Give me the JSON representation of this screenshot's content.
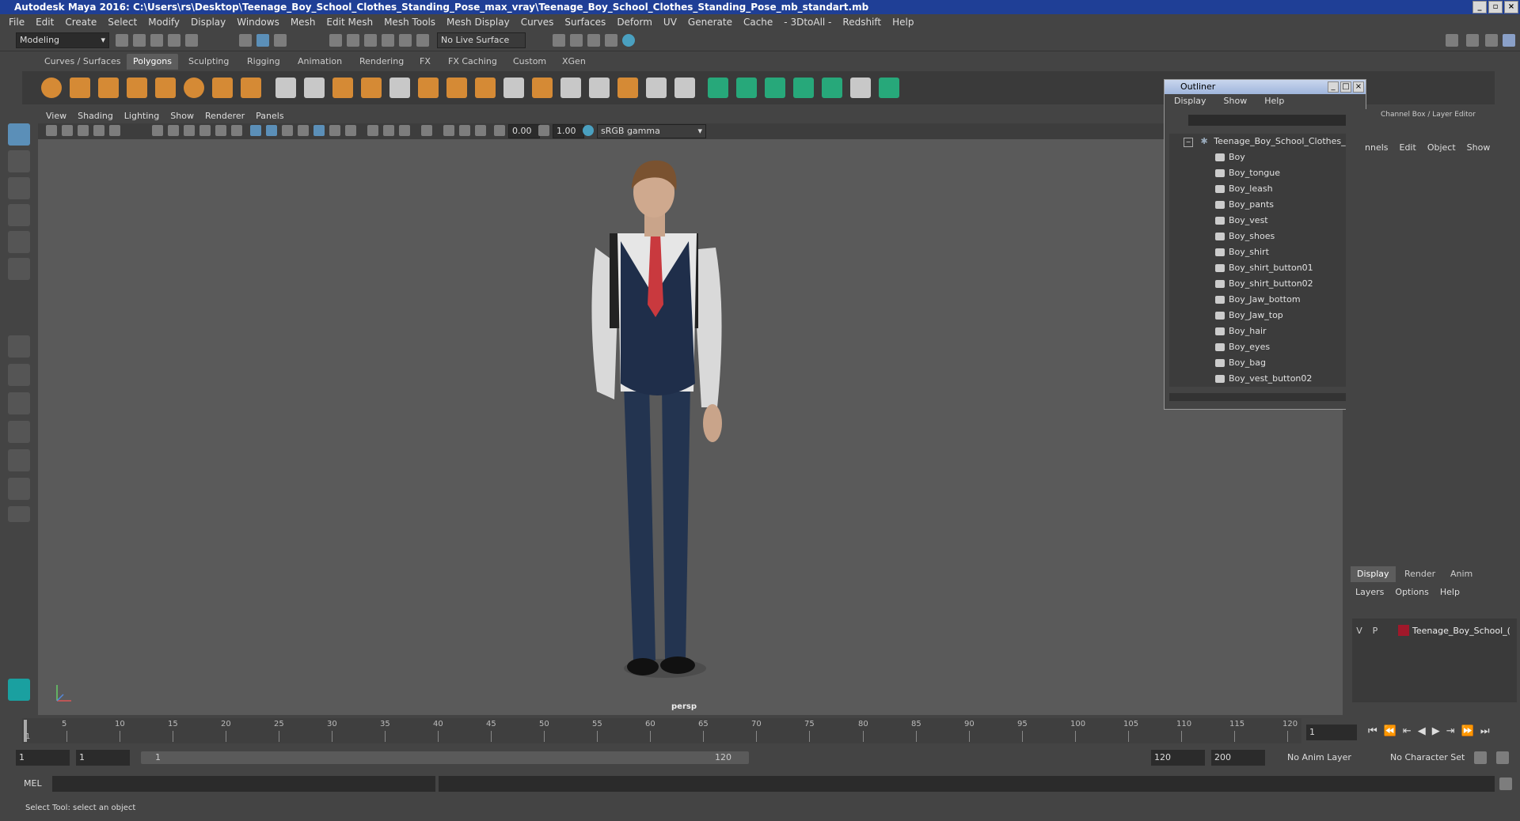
{
  "window": {
    "title": "Autodesk Maya 2016: C:\\Users\\rs\\Desktop\\Teenage_Boy_School_Clothes_Standing_Pose_max_vray\\Teenage_Boy_School_Clothes_Standing_Pose_mb_standart.mb"
  },
  "menubar": [
    "File",
    "Edit",
    "Create",
    "Select",
    "Modify",
    "Display",
    "Windows",
    "Mesh",
    "Edit Mesh",
    "Mesh Tools",
    "Mesh Display",
    "Curves",
    "Surfaces",
    "Deform",
    "UV",
    "Generate",
    "Cache",
    "- 3DtoAll -",
    "Redshift",
    "Help"
  ],
  "statusline": {
    "mode": "Modeling",
    "live_surface": "No Live Surface"
  },
  "shelf": {
    "tabs": [
      "Curves / Surfaces",
      "Polygons",
      "Sculpting",
      "Rigging",
      "Animation",
      "Rendering",
      "FX",
      "FX Caching",
      "Custom",
      "XGen"
    ],
    "active": "Polygons"
  },
  "viewport": {
    "menu": [
      "View",
      "Shading",
      "Lighting",
      "Show",
      "Renderer",
      "Panels"
    ],
    "exposure": "0.00",
    "gamma": "1.00",
    "color_space": "sRGB gamma",
    "camera": "persp"
  },
  "outliner": {
    "title": "Outliner",
    "menu": [
      "Display",
      "Show",
      "Help"
    ],
    "root": "Teenage_Boy_School_Clothes_Sta",
    "items": [
      "Boy",
      "Boy_tongue",
      "Boy_leash",
      "Boy_pants",
      "Boy_vest",
      "Boy_shoes",
      "Boy_shirt",
      "Boy_shirt_button01",
      "Boy_shirt_button02",
      "Boy_Jaw_bottom",
      "Boy_Jaw_top",
      "Boy_hair",
      "Boy_eyes",
      "Boy_bag",
      "Boy_vest_button02"
    ]
  },
  "channelbox": {
    "title": "Channel Box / Layer Editor",
    "menu": [
      "nnels",
      "Edit",
      "Object",
      "Show"
    ]
  },
  "layers": {
    "tabs": [
      "Display",
      "Render",
      "Anim"
    ],
    "active": "Display",
    "menu": [
      "Layers",
      "Options",
      "Help"
    ],
    "row": {
      "v": "V",
      "p": "P",
      "name": "Teenage_Boy_School_(",
      "color": "#a0182a"
    }
  },
  "timeline": {
    "ticks": [
      "5",
      "10",
      "15",
      "20",
      "25",
      "30",
      "35",
      "40",
      "45",
      "50",
      "55",
      "60",
      "65",
      "70",
      "75",
      "80",
      "85",
      "90",
      "95",
      "100",
      "105",
      "110",
      "115",
      "120"
    ],
    "current_marker": "1",
    "current_frame": "1"
  },
  "range": {
    "start": "1",
    "start2": "1",
    "slider_start": "1",
    "slider_end": "120",
    "end": "120",
    "end2": "200",
    "anim_layer": "No Anim Layer",
    "character_set": "No Character Set"
  },
  "cmdline": {
    "label": "MEL"
  },
  "helpline": {
    "text": "Select Tool: select an object"
  }
}
